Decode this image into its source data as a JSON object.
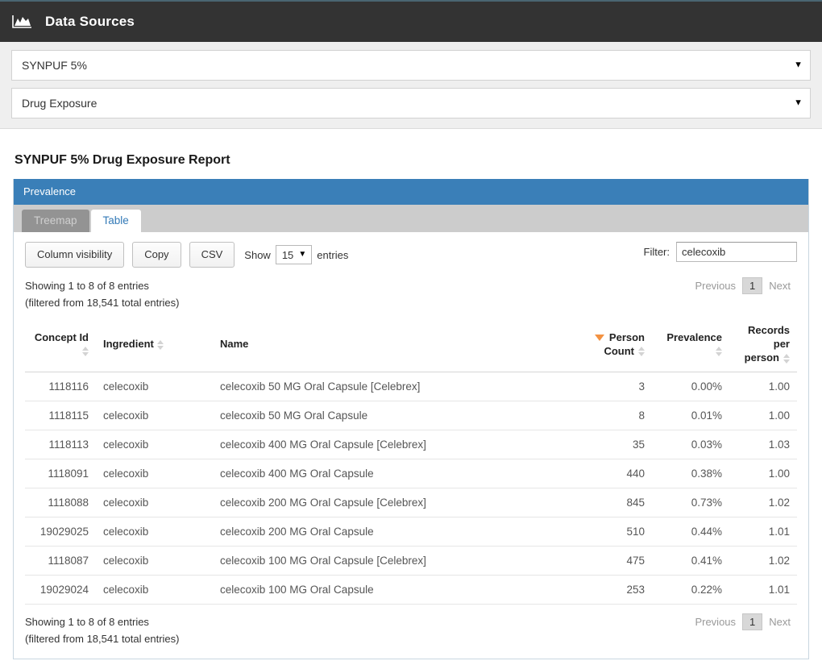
{
  "appbar": {
    "icon": "area-chart-icon",
    "title": "Data Sources"
  },
  "selectors": [
    {
      "name": "data-source-select",
      "value": "SYNPUF 5%",
      "caret": "▼"
    },
    {
      "name": "report-type-select",
      "value": "Drug Exposure",
      "caret": "▼"
    }
  ],
  "report": {
    "title": "SYNPUF 5% Drug Exposure Report"
  },
  "panel": {
    "heading": "Prevalence"
  },
  "tabs": [
    {
      "label": "Treemap",
      "active": false
    },
    {
      "label": "Table",
      "active": true
    }
  ],
  "toolbar": {
    "column_visibility_label": "Column visibility",
    "copy_label": "Copy",
    "csv_label": "CSV",
    "show_label": "Show",
    "entries_label": "entries",
    "page_length": "15",
    "page_length_caret": "▼",
    "filter_label": "Filter:",
    "filter_value": "celecoxib",
    "filter_placeholder": ""
  },
  "info": {
    "line1": "Showing 1 to 8 of 8 entries",
    "line2": "(filtered from 18,541 total entries)"
  },
  "paginate": {
    "previous": "Previous",
    "current": "1",
    "next": "Next"
  },
  "table": {
    "columns": [
      {
        "label": "Concept Id",
        "align": "right",
        "sort": "none"
      },
      {
        "label": "Ingredient",
        "align": "left",
        "sort": "none"
      },
      {
        "label": "Name",
        "align": "left",
        "sort": "none"
      },
      {
        "label": "Person Count",
        "align": "right",
        "sort": "desc"
      },
      {
        "label": "Prevalence",
        "align": "right",
        "sort": "none"
      },
      {
        "label": "Records per person",
        "align": "right",
        "sort": "none"
      }
    ],
    "rows": [
      {
        "concept_id": "1118116",
        "ingredient": "celecoxib",
        "name": "celecoxib 50 MG Oral Capsule [Celebrex]",
        "person_count": "3",
        "prevalence": "0.00%",
        "records_per_person": "1.00"
      },
      {
        "concept_id": "1118115",
        "ingredient": "celecoxib",
        "name": "celecoxib 50 MG Oral Capsule",
        "person_count": "8",
        "prevalence": "0.01%",
        "records_per_person": "1.00"
      },
      {
        "concept_id": "1118113",
        "ingredient": "celecoxib",
        "name": "celecoxib 400 MG Oral Capsule [Celebrex]",
        "person_count": "35",
        "prevalence": "0.03%",
        "records_per_person": "1.03"
      },
      {
        "concept_id": "1118091",
        "ingredient": "celecoxib",
        "name": "celecoxib 400 MG Oral Capsule",
        "person_count": "440",
        "prevalence": "0.38%",
        "records_per_person": "1.00"
      },
      {
        "concept_id": "1118088",
        "ingredient": "celecoxib",
        "name": "celecoxib 200 MG Oral Capsule [Celebrex]",
        "person_count": "845",
        "prevalence": "0.73%",
        "records_per_person": "1.02"
      },
      {
        "concept_id": "19029025",
        "ingredient": "celecoxib",
        "name": "celecoxib 200 MG Oral Capsule",
        "person_count": "510",
        "prevalence": "0.44%",
        "records_per_person": "1.01"
      },
      {
        "concept_id": "1118087",
        "ingredient": "celecoxib",
        "name": "celecoxib 100 MG Oral Capsule [Celebrex]",
        "person_count": "475",
        "prevalence": "0.41%",
        "records_per_person": "1.02"
      },
      {
        "concept_id": "19029024",
        "ingredient": "celecoxib",
        "name": "celecoxib 100 MG Oral Capsule",
        "person_count": "253",
        "prevalence": "0.22%",
        "records_per_person": "1.01"
      }
    ]
  },
  "colors": {
    "appbar_bg": "#333333",
    "panel_heading_bg": "#3a7fb8",
    "tab_active_text": "#337ab7",
    "sort_desc_accent": "#f39242"
  }
}
